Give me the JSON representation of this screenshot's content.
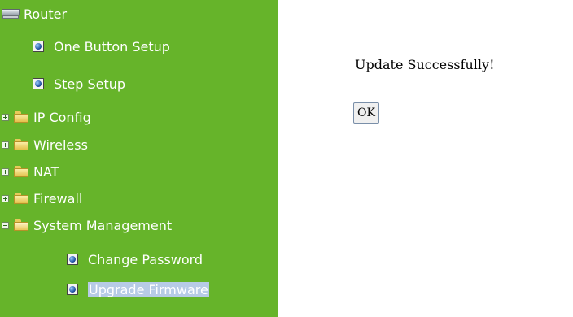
{
  "sidebar": {
    "root_label": "Router",
    "items": [
      {
        "label": "One Button Setup",
        "icon": "page-icon"
      },
      {
        "label": "Step Setup",
        "icon": "page-icon"
      },
      {
        "label": "IP Config",
        "icon": "folder-icon",
        "expander": "plus"
      },
      {
        "label": "Wireless",
        "icon": "folder-icon",
        "expander": "plus"
      },
      {
        "label": "NAT",
        "icon": "folder-icon",
        "expander": "plus"
      },
      {
        "label": "Firewall",
        "icon": "folder-icon",
        "expander": "plus"
      },
      {
        "label": "System Management",
        "icon": "open-folder-icon",
        "expander": "minus"
      },
      {
        "label": "Change Password",
        "icon": "page-icon"
      },
      {
        "label": "Upgrade Firmware",
        "icon": "page-icon",
        "selected": true
      }
    ]
  },
  "main": {
    "message": "Update Successfully!",
    "ok_label": "OK"
  },
  "colors": {
    "sidebar_bg": "#66b42a",
    "selection": "#b7cbe6"
  }
}
